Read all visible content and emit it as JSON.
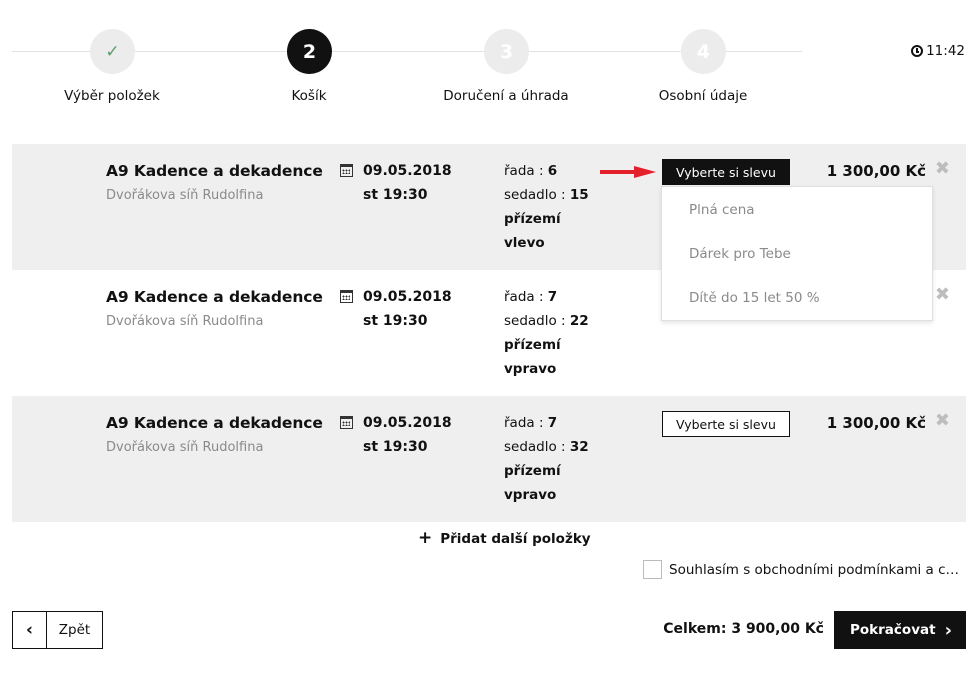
{
  "stepper": {
    "steps": [
      {
        "number": "✓",
        "label": "Výběr položek"
      },
      {
        "number": "2",
        "label": "Košík"
      },
      {
        "number": "3",
        "label": "Doručení a úhrada"
      },
      {
        "number": "4",
        "label": "Osobní údaje"
      }
    ],
    "timer": "11:42"
  },
  "cart": {
    "items": [
      {
        "title": "A9 Kadence a dekadence",
        "venue": "Dvořákova síň Rudolfina",
        "date": "09.05.2018",
        "time": "st 19:30",
        "row_label": "řada : ",
        "row": "6",
        "seat_label": "sedadlo : ",
        "seat": "15",
        "section1": "přízemí",
        "section2": "vlevo",
        "discount_label": "Vyberte si slevu",
        "price": "1 300,00 Kč"
      },
      {
        "title": "A9 Kadence a dekadence",
        "venue": "Dvořákova síň Rudolfina",
        "date": "09.05.2018",
        "time": "st 19:30",
        "row_label": "řada : ",
        "row": "7",
        "seat_label": "sedadlo : ",
        "seat": "22",
        "section1": "přízemí",
        "section2": "vpravo"
      },
      {
        "title": "A9 Kadence a dekadence",
        "venue": "Dvořákova síň Rudolfina",
        "date": "09.05.2018",
        "time": "st 19:30",
        "row_label": "řada : ",
        "row": "7",
        "seat_label": "sedadlo : ",
        "seat": "32",
        "section1": "přízemí",
        "section2": "vpravo",
        "discount_label": "Vyberte si slevu",
        "price": "1 300,00 Kč"
      }
    ],
    "discount_options": [
      "Plná cena",
      "Dárek pro Tebe",
      "Dítě do 15 let 50 %"
    ]
  },
  "footer": {
    "add_more": "Přidat další položky",
    "terms": "Souhlasím s obchodními podmínkami a chci...",
    "back": "Zpět",
    "total": "Celkem: 3 900,00 Kč",
    "continue": "Pokračovat"
  },
  "colors": {
    "accent": "#111111",
    "row_bg": "#efefef",
    "annotation_arrow": "#e4202a",
    "done_check": "#5b9c6a"
  }
}
